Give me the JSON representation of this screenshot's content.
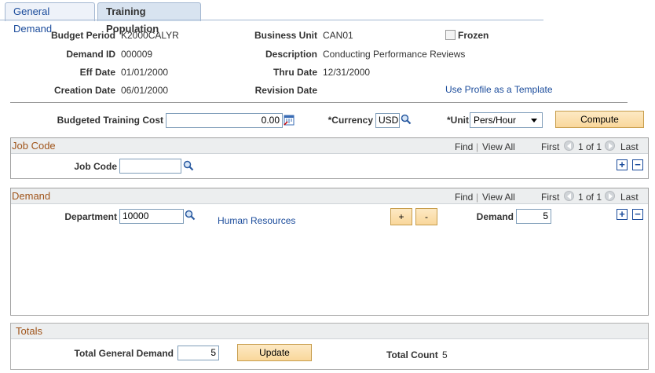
{
  "tabs": [
    {
      "label": "General Demand",
      "active": false
    },
    {
      "label": "Training Population",
      "active": true
    }
  ],
  "header": {
    "budget_period_label": "Budget Period",
    "budget_period_value": "K2000CALYR",
    "business_unit_label": "Business Unit",
    "business_unit_value": "CAN01",
    "frozen_label": "Frozen",
    "frozen_checked": false,
    "demand_id_label": "Demand ID",
    "demand_id_value": "000009",
    "description_label": "Description",
    "description_value": "Conducting Performance Reviews",
    "eff_date_label": "Eff Date",
    "eff_date_value": "01/01/2000",
    "thru_date_label": "Thru Date",
    "thru_date_value": "12/31/2000",
    "creation_date_label": "Creation Date",
    "creation_date_value": "06/01/2000",
    "revision_date_label": "Revision Date",
    "revision_date_value": "",
    "profile_link": "Use Profile as a Template"
  },
  "cost_row": {
    "budgeted_cost_label": "Budgeted Training Cost",
    "budgeted_cost_value": "0.00",
    "currency_label": "*Currency",
    "currency_value": "USD",
    "unit_label": "*Unit",
    "unit_value": "Pers/Hour",
    "compute_label": "Compute"
  },
  "job_code_grid": {
    "title": "Job Code",
    "find": "Find",
    "sep": "|",
    "view_all": "View All",
    "first": "First",
    "range": "1 of 1",
    "last": "Last",
    "field_label": "Job Code",
    "field_value": ""
  },
  "demand_grid": {
    "title": "Demand",
    "find": "Find",
    "sep": "|",
    "view_all": "View All",
    "first": "First",
    "range": "1 of 1",
    "last": "Last",
    "department_label": "Department",
    "department_value": "10000",
    "department_name": "Human Resources",
    "plus_label": "+",
    "minus_label": "-",
    "demand_label": "Demand",
    "demand_value": "5"
  },
  "totals": {
    "title": "Totals",
    "total_general_demand_label": "Total General Demand",
    "total_general_demand_value": "5",
    "update_label": "Update",
    "total_count_label": "Total Count",
    "total_count_value": "5"
  },
  "colors": {
    "link": "#1a4b9b",
    "grid_title": "#a0541a",
    "button": "#f9d79b"
  },
  "icons": {
    "lookup": "magnifier-icon",
    "calendar": "calendar-icon",
    "add_row": "plus-icon",
    "delete_row": "minus-icon"
  }
}
